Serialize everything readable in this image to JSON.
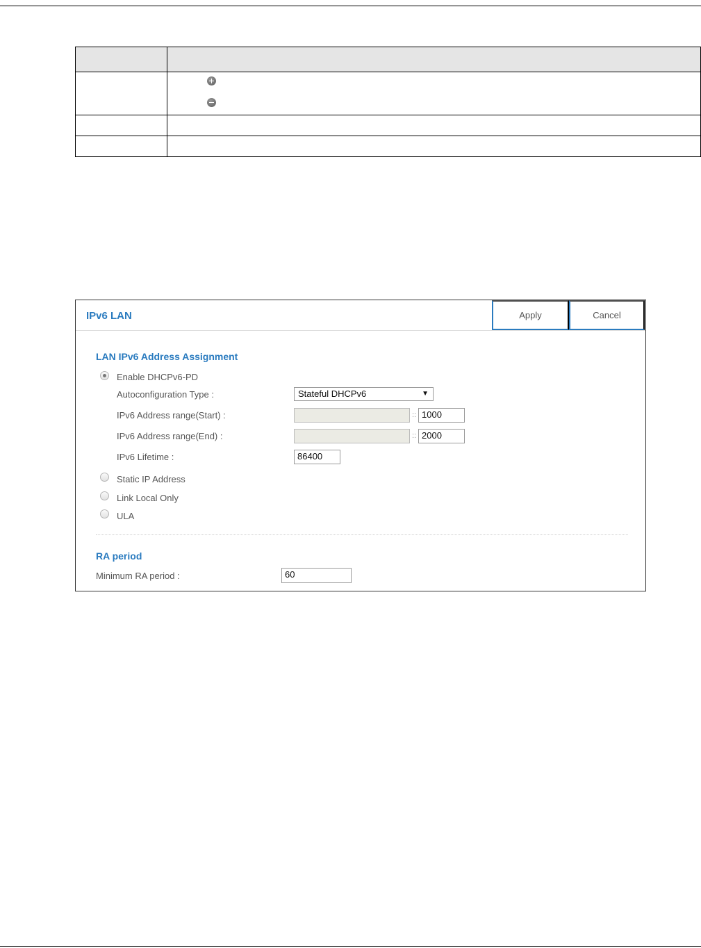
{
  "table": {
    "rows": [
      {
        "type": "header"
      },
      {
        "type": "icons",
        "icons": [
          "add-icon",
          "remove-icon"
        ]
      },
      {
        "type": "plain"
      },
      {
        "type": "plain"
      }
    ]
  },
  "panel": {
    "title": "IPv6 LAN",
    "apply_label": "Apply",
    "cancel_label": "Cancel",
    "assignment": {
      "title": "LAN IPv6 Address Assignment",
      "options": {
        "dhcp_pd": {
          "label": "Enable DHCPv6-PD",
          "checked": true
        },
        "static_ip": {
          "label": "Static IP Address",
          "checked": false
        },
        "link_local": {
          "label": "Link Local Only",
          "checked": false
        },
        "ula": {
          "label": "ULA",
          "checked": false
        }
      },
      "autoconfig_label": "Autoconfiguration Type :",
      "autoconfig_value": "Stateful DHCPv6",
      "range_start_label": "IPv6 Address range(Start) :",
      "range_start_prefix": "",
      "range_start_value": "1000",
      "range_end_label": "IPv6 Address range(End) :",
      "range_end_prefix": "",
      "range_end_value": "2000",
      "separator": "::",
      "lifetime_label": "IPv6 Lifetime :",
      "lifetime_value": "86400"
    },
    "ra": {
      "title": "RA period",
      "min_label": "Minimum RA period :",
      "min_value": "60"
    }
  }
}
